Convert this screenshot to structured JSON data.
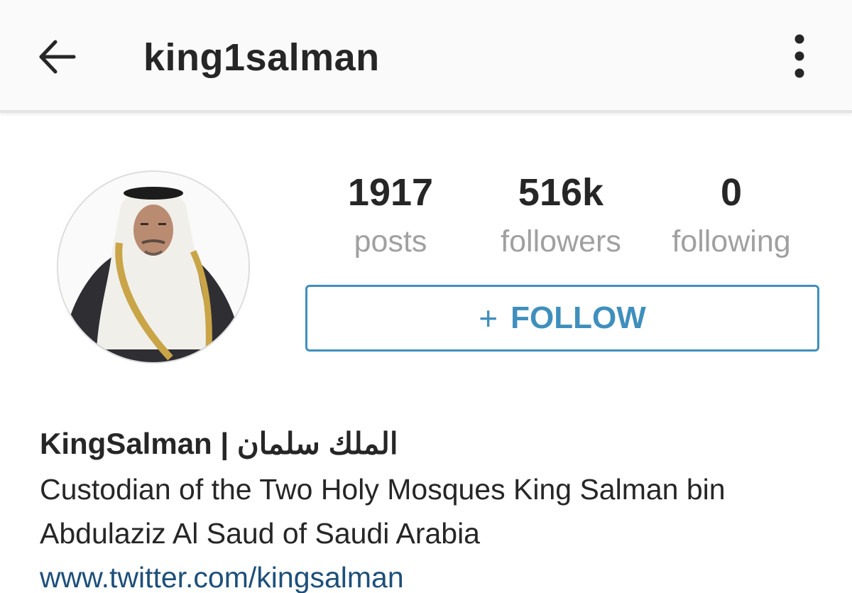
{
  "header": {
    "username": "king1salman",
    "back_icon": "arrow-left-icon",
    "menu_icon": "more-vertical-icon"
  },
  "profile": {
    "avatar": "profile-photo",
    "stats": {
      "posts": {
        "value": "1917",
        "label": "posts"
      },
      "followers": {
        "value": "516k",
        "label": "followers"
      },
      "following": {
        "value": "0",
        "label": "following"
      }
    },
    "follow_button": {
      "icon": "+",
      "label": "FOLLOW"
    }
  },
  "bio": {
    "display_name": "KingSalman | الملك سلمان",
    "description": "Custodian of the Two Holy Mosques King Salman bin Abdulaziz Al Saud of Saudi Arabia",
    "link": "www.twitter.com/kingsalman"
  },
  "colors": {
    "accent": "#3f8fbd",
    "link": "#1e4f7a",
    "text": "#262626",
    "muted": "#a0a0a0"
  }
}
